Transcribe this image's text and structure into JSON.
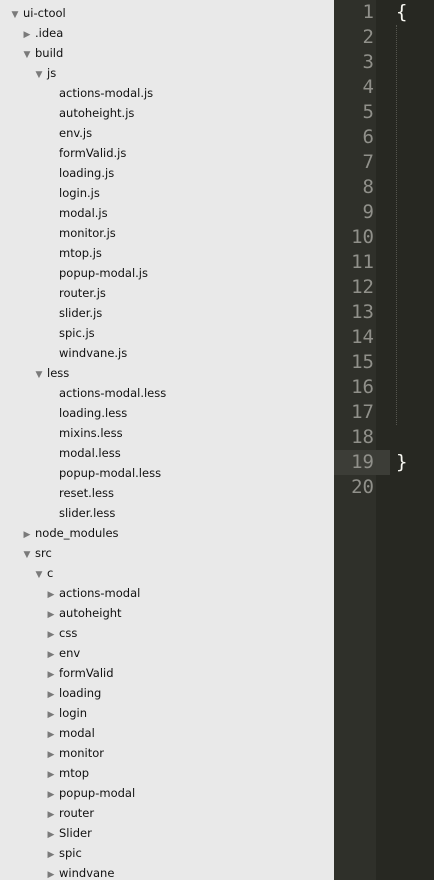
{
  "sidebar": {
    "items": [
      {
        "label": "ui-ctool",
        "depth": 0,
        "arrow": "down"
      },
      {
        "label": ".idea",
        "depth": 1,
        "arrow": "right"
      },
      {
        "label": "build",
        "depth": 1,
        "arrow": "down"
      },
      {
        "label": "js",
        "depth": 2,
        "arrow": "down"
      },
      {
        "label": "actions-modal.js",
        "depth": 3,
        "arrow": "none"
      },
      {
        "label": "autoheight.js",
        "depth": 3,
        "arrow": "none"
      },
      {
        "label": "env.js",
        "depth": 3,
        "arrow": "none"
      },
      {
        "label": "formValid.js",
        "depth": 3,
        "arrow": "none"
      },
      {
        "label": "loading.js",
        "depth": 3,
        "arrow": "none"
      },
      {
        "label": "login.js",
        "depth": 3,
        "arrow": "none"
      },
      {
        "label": "modal.js",
        "depth": 3,
        "arrow": "none"
      },
      {
        "label": "monitor.js",
        "depth": 3,
        "arrow": "none"
      },
      {
        "label": "mtop.js",
        "depth": 3,
        "arrow": "none"
      },
      {
        "label": "popup-modal.js",
        "depth": 3,
        "arrow": "none"
      },
      {
        "label": "router.js",
        "depth": 3,
        "arrow": "none"
      },
      {
        "label": "slider.js",
        "depth": 3,
        "arrow": "none"
      },
      {
        "label": "spic.js",
        "depth": 3,
        "arrow": "none"
      },
      {
        "label": "windvane.js",
        "depth": 3,
        "arrow": "none"
      },
      {
        "label": "less",
        "depth": 2,
        "arrow": "down"
      },
      {
        "label": "actions-modal.less",
        "depth": 3,
        "arrow": "none"
      },
      {
        "label": "loading.less",
        "depth": 3,
        "arrow": "none"
      },
      {
        "label": "mixins.less",
        "depth": 3,
        "arrow": "none"
      },
      {
        "label": "modal.less",
        "depth": 3,
        "arrow": "none"
      },
      {
        "label": "popup-modal.less",
        "depth": 3,
        "arrow": "none"
      },
      {
        "label": "reset.less",
        "depth": 3,
        "arrow": "none"
      },
      {
        "label": "slider.less",
        "depth": 3,
        "arrow": "none"
      },
      {
        "label": "node_modules",
        "depth": 1,
        "arrow": "right"
      },
      {
        "label": "src",
        "depth": 1,
        "arrow": "down"
      },
      {
        "label": "c",
        "depth": 2,
        "arrow": "down"
      },
      {
        "label": "actions-modal",
        "depth": 3,
        "arrow": "right"
      },
      {
        "label": "autoheight",
        "depth": 3,
        "arrow": "right"
      },
      {
        "label": "css",
        "depth": 3,
        "arrow": "right"
      },
      {
        "label": "env",
        "depth": 3,
        "arrow": "right"
      },
      {
        "label": "formValid",
        "depth": 3,
        "arrow": "right"
      },
      {
        "label": "loading",
        "depth": 3,
        "arrow": "right"
      },
      {
        "label": "login",
        "depth": 3,
        "arrow": "right"
      },
      {
        "label": "modal",
        "depth": 3,
        "arrow": "right"
      },
      {
        "label": "monitor",
        "depth": 3,
        "arrow": "right"
      },
      {
        "label": "mtop",
        "depth": 3,
        "arrow": "right"
      },
      {
        "label": "popup-modal",
        "depth": 3,
        "arrow": "right"
      },
      {
        "label": "router",
        "depth": 3,
        "arrow": "right"
      },
      {
        "label": "Slider",
        "depth": 3,
        "arrow": "right"
      },
      {
        "label": "spic",
        "depth": 3,
        "arrow": "right"
      },
      {
        "label": "windvane",
        "depth": 3,
        "arrow": "right"
      }
    ]
  },
  "editor": {
    "active_line": 19,
    "lines": [
      {
        "number": "1",
        "code": "{"
      },
      {
        "number": "2",
        "code": ""
      },
      {
        "number": "3",
        "code": ""
      },
      {
        "number": "4",
        "code": ""
      },
      {
        "number": "5",
        "code": ""
      },
      {
        "number": "6",
        "code": ""
      },
      {
        "number": "7",
        "code": ""
      },
      {
        "number": "8",
        "code": ""
      },
      {
        "number": "9",
        "code": ""
      },
      {
        "number": "10",
        "code": ""
      },
      {
        "number": "11",
        "code": ""
      },
      {
        "number": "12",
        "code": ""
      },
      {
        "number": "13",
        "code": ""
      },
      {
        "number": "14",
        "code": ""
      },
      {
        "number": "15",
        "code": ""
      },
      {
        "number": "16",
        "code": ""
      },
      {
        "number": "17",
        "code": ""
      },
      {
        "number": "18",
        "code": ""
      },
      {
        "number": "19",
        "code": "}"
      },
      {
        "number": "20",
        "code": ""
      }
    ]
  },
  "colors": {
    "sidebar_bg": "#e9e9e9",
    "editor_bg": "#272822",
    "line_number": "#90908a",
    "code_text": "#f8f8f2",
    "active_line_bg": "#3c3d37"
  }
}
